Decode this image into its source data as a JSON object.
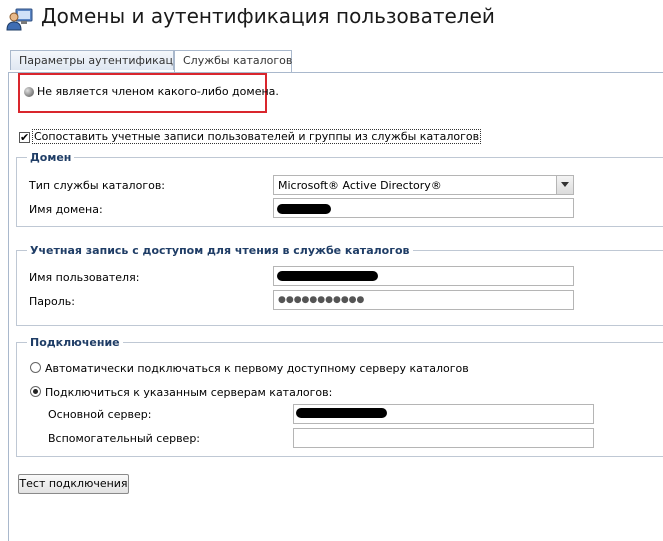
{
  "header": {
    "title": "Домены и аутентификация пользователей",
    "icon": "users-domain-icon"
  },
  "tabs": [
    {
      "label": "Параметры аутентификации",
      "active": false
    },
    {
      "label": "Службы каталогов",
      "active": true
    }
  ],
  "status": {
    "text": "Не является членом какого-либо домена.",
    "icon": "status-gray-dot-icon"
  },
  "map_accounts": {
    "label": "Сопоставить учетные записи пользователей и группы из службы каталогов",
    "checked": true
  },
  "domain": {
    "legend": "Домен",
    "type_label": "Тип службы каталогов:",
    "type_value": "Microsoft® Active Directory®",
    "name_label": "Имя домена:"
  },
  "readonly_account": {
    "legend": "Учетная запись с доступом для чтения в службе каталогов",
    "user_label": "Имя пользователя:",
    "password_label": "Пароль:",
    "password_mask": "●●●●●●●●●●●"
  },
  "connection": {
    "legend": "Подключение",
    "auto_label": "Автоматически подключаться к первому доступному серверу каталогов",
    "specific_label": "Подключиться к указанным серверам каталогов:",
    "selected": "specific",
    "primary_label": "Основной сервер:",
    "secondary_label": "Вспомогательный сервер:"
  },
  "actions": {
    "test_label": "Тест подключения"
  },
  "colors": {
    "highlight_border": "#d9262d",
    "legend_text": "#1f3d66"
  }
}
